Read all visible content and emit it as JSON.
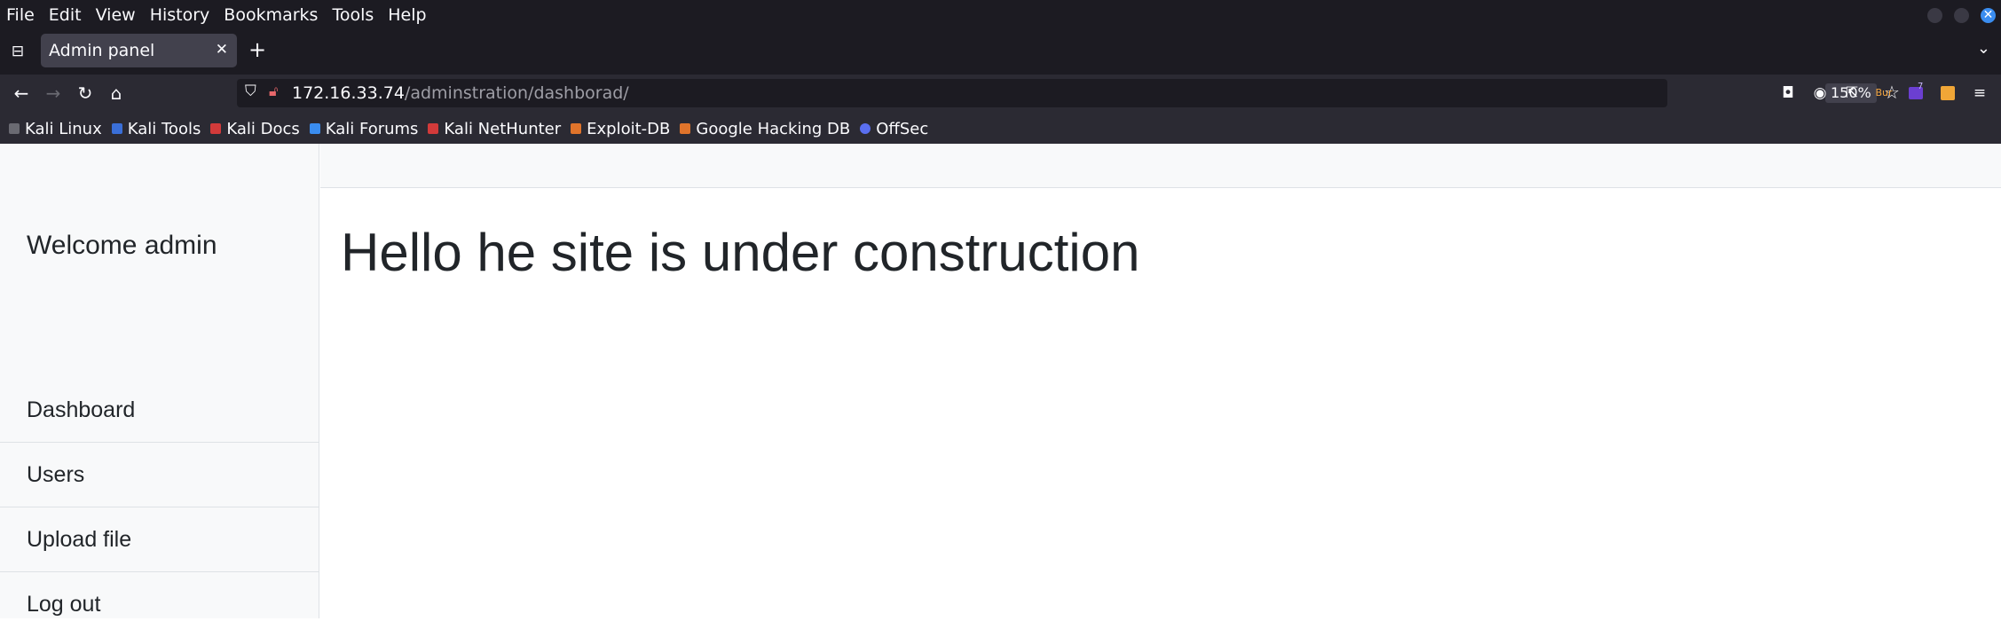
{
  "browser": {
    "menu": [
      "File",
      "Edit",
      "View",
      "History",
      "Bookmarks",
      "Tools",
      "Help"
    ],
    "tab": {
      "title": "Admin panel"
    },
    "url": {
      "host": "172.16.33.74",
      "path": "/adminstration/dashborad/"
    },
    "zoom": "150%",
    "bookmarks": [
      {
        "label": "Kali Linux",
        "color": "#6a6a72"
      },
      {
        "label": "Kali Tools",
        "color": "#3a6fd8"
      },
      {
        "label": "Kali Docs",
        "color": "#d23a3a"
      },
      {
        "label": "Kali Forums",
        "color": "#3a8df0"
      },
      {
        "label": "Kali NetHunter",
        "color": "#d23a3a"
      },
      {
        "label": "Exploit-DB",
        "color": "#e0742b"
      },
      {
        "label": "Google Hacking DB",
        "color": "#e0742b"
      },
      {
        "label": "OffSec",
        "color": "#5a6ff0"
      }
    ],
    "extension_badge": "7",
    "extension_label": "Bur"
  },
  "page": {
    "sidebar": {
      "heading": "Welcome admin",
      "links": [
        "Dashboard",
        "Users",
        "Upload file",
        "Log out"
      ]
    },
    "main": {
      "heading": "Hello he site is under construction"
    }
  }
}
